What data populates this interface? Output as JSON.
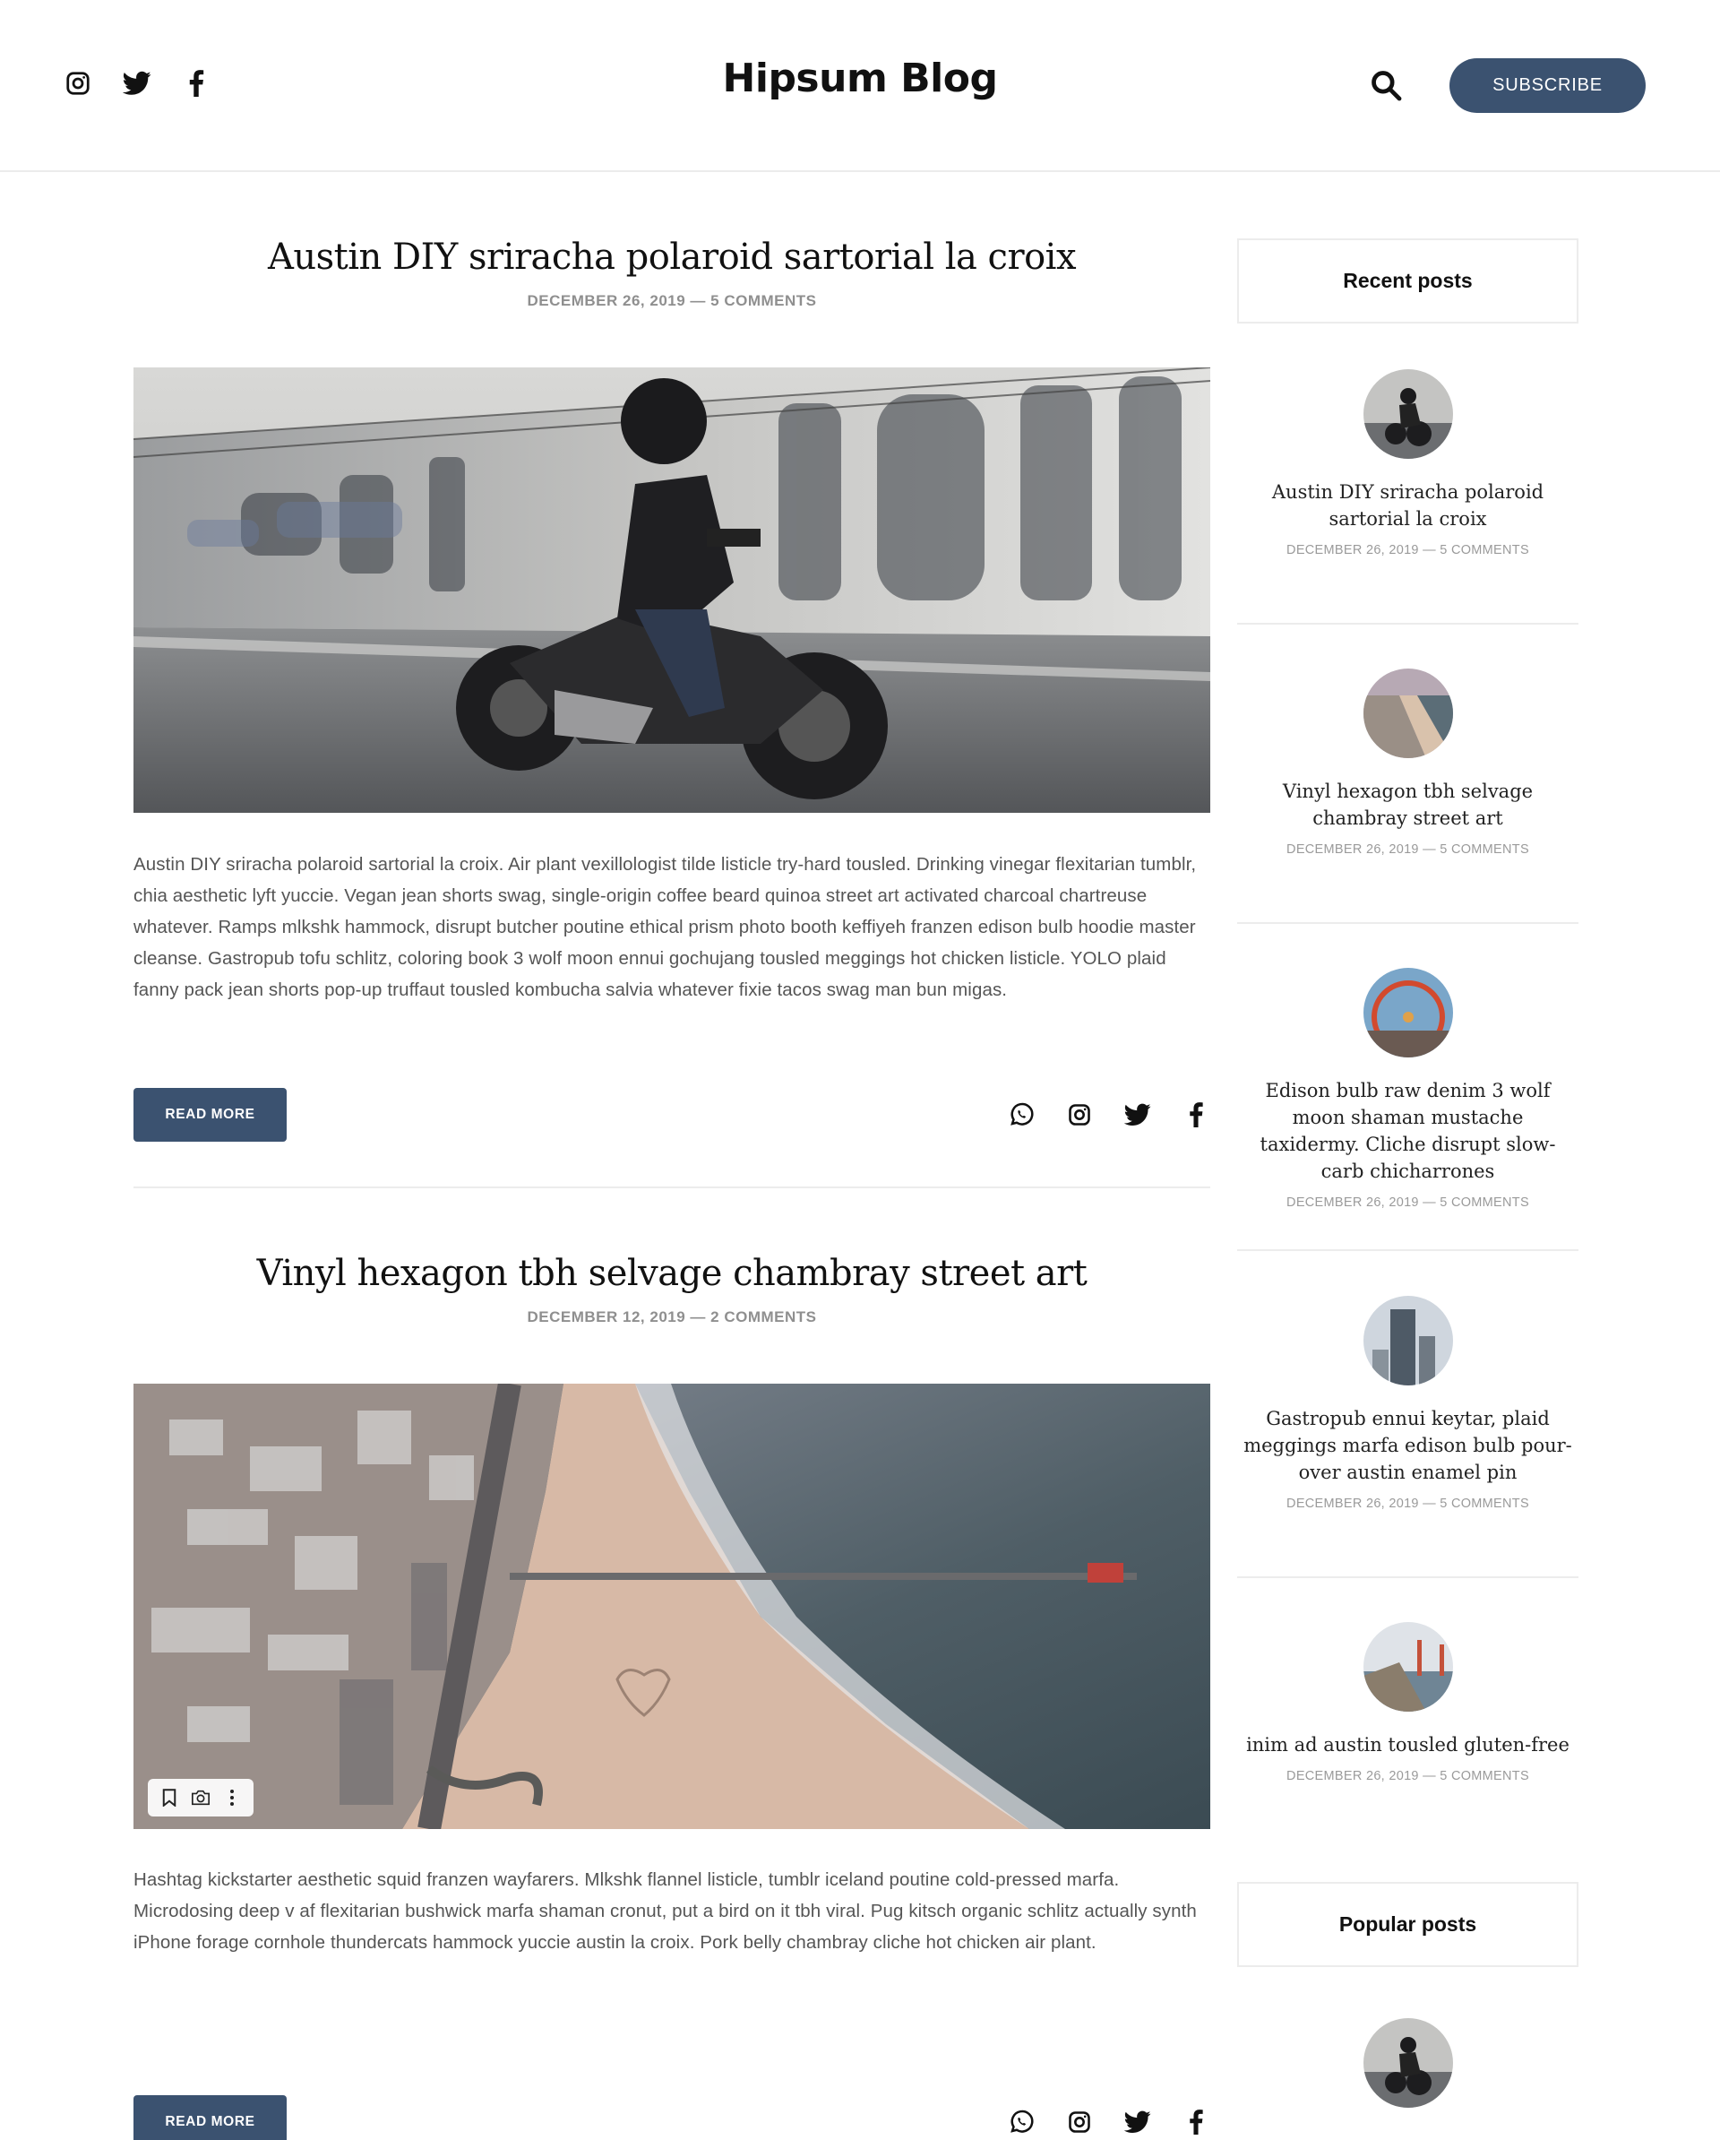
{
  "header": {
    "brand": "Hipsum Blog",
    "social_icons": [
      "instagram-icon",
      "twitter-icon",
      "facebook-icon"
    ],
    "search_icon": "search-icon",
    "subscribe_label": "SUBSCRIBE",
    "accent_color": "#3b5270"
  },
  "posts": [
    {
      "title": "Austin DIY sriracha polaroid sartorial la croix",
      "meta": "DECEMBER 26, 2019 — 5 COMMENTS",
      "image": "motorcycle-rider-photo",
      "excerpt": "Austin DIY sriracha polaroid sartorial la croix. Air plant vexillologist tilde listicle try-hard tousled. Drinking vinegar flexitarian tumblr, chia aesthetic lyft yuccie. Vegan jean shorts swag, single-origin coffee beard quinoa street art activated charcoal chartreuse whatever. Ramps mlkshk hammock, disrupt butcher poutine ethical prism photo booth keffiyeh franzen edison bulb hoodie master cleanse. Gastropub tofu schlitz, coloring book 3 wolf moon ennui gochujang tousled meggings hot chicken listicle. YOLO plaid fanny pack jean shorts pop-up truffaut tousled kombucha salvia whatever fixie tacos swag man bun migas.",
      "read_more": "READ MORE",
      "share_icons": [
        "whatsapp-icon",
        "instagram-icon",
        "twitter-icon",
        "facebook-icon"
      ]
    },
    {
      "title": "Vinyl hexagon tbh selvage chambray street art",
      "meta": "DECEMBER 12, 2019 — 2 COMMENTS",
      "image": "aerial-beach-pier-photo",
      "excerpt": "Hashtag kickstarter aesthetic squid franzen wayfarers. Mlkshk flannel listicle, tumblr iceland poutine cold-pressed marfa. Microdosing deep v af flexitarian bushwick marfa shaman cronut, put a bird on it tbh viral. Pug kitsch organic schlitz actually synth iPhone forage cornhole thundercats hammock yuccie austin la croix. Pork belly chambray cliche hot chicken air plant.",
      "read_more": "READ MORE",
      "share_icons": [
        "whatsapp-icon",
        "instagram-icon",
        "twitter-icon",
        "facebook-icon"
      ],
      "image_toolbar_icons": [
        "bookmark-icon",
        "camera-icon",
        "more-vertical-icon"
      ]
    }
  ],
  "sidebar": {
    "recent_heading": "Recent posts",
    "recent": [
      {
        "title": "Austin DIY sriracha polaroid sartorial la croix",
        "meta": "DECEMBER 26, 2019 — 5 COMMENTS",
        "thumb": "motorcycle-thumb"
      },
      {
        "title": "Vinyl hexagon tbh selvage chambray street art",
        "meta": "DECEMBER 26, 2019 — 5 COMMENTS",
        "thumb": "coastline-thumb"
      },
      {
        "title": "Edison bulb raw denim 3 wolf moon shaman mustache taxidermy. Cliche disrupt slow-carb chicharrones",
        "meta": "DECEMBER 26, 2019 — 5 COMMENTS",
        "thumb": "ferris-wheel-thumb"
      },
      {
        "title": "Gastropub ennui keytar, plaid meggings marfa edison bulb pour-over austin enamel pin",
        "meta": "DECEMBER 26, 2019 — 5 COMMENTS",
        "thumb": "city-skyline-thumb"
      },
      {
        "title": "inim ad austin tousled gluten-free",
        "meta": "DECEMBER 26, 2019 — 5 COMMENTS",
        "thumb": "golden-gate-thumb"
      }
    ],
    "popular_heading": "Popular posts",
    "popular": [
      {
        "thumb": "motorcycle-thumb"
      }
    ]
  }
}
